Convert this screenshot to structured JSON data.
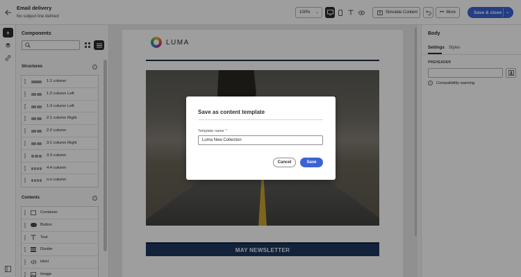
{
  "header": {
    "title": "Email delivery",
    "subtitle": "No subject line defined",
    "zoom": "100%",
    "simulate_label": "Simulate Content",
    "more_label": "More",
    "save_close_label": "Save & close"
  },
  "components": {
    "title": "Components",
    "structures_label": "Structures",
    "structures": [
      {
        "label": "1:1 column",
        "cols": 1
      },
      {
        "label": "1:2 column Left",
        "cols": 2
      },
      {
        "label": "1:3 column Left",
        "cols": 2
      },
      {
        "label": "2:1 column Right",
        "cols": 2
      },
      {
        "label": "2:2 column",
        "cols": 2
      },
      {
        "label": "3:1 column Right",
        "cols": 2
      },
      {
        "label": "3:3 column",
        "cols": 3
      },
      {
        "label": "4:4 column",
        "cols": 4
      },
      {
        "label": "n:n column",
        "cols": 4
      }
    ],
    "contents_label": "Contents",
    "contents": [
      {
        "label": "Container",
        "icon": "container-icon"
      },
      {
        "label": "Button",
        "icon": "button-icon"
      },
      {
        "label": "Text",
        "icon": "text-icon"
      },
      {
        "label": "Divider",
        "icon": "divider-icon"
      },
      {
        "label": "Html",
        "icon": "html-icon"
      },
      {
        "label": "Image",
        "icon": "image-icon"
      }
    ]
  },
  "email": {
    "logo_text": "LUMA",
    "banner_text": "MAY NEWSLETTER"
  },
  "right_panel": {
    "title": "Body",
    "tabs": [
      "Settings",
      "Styles"
    ],
    "active_tab": "Settings",
    "preheader_label": "PREHEADER",
    "warning": "Compatibility warning"
  },
  "dialog": {
    "title": "Save as content template",
    "field_label": "Template name",
    "required_mark": "*",
    "field_value": "Luma New Collection",
    "cancel_label": "Cancel",
    "save_label": "Save"
  },
  "colors": {
    "accent": "#3b63d6",
    "banner": "#1e3760"
  }
}
